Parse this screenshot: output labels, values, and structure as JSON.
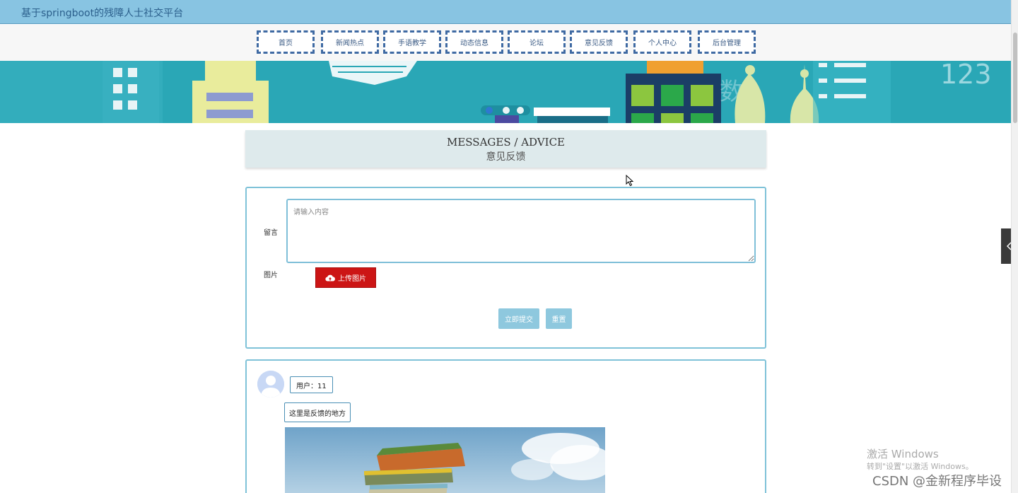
{
  "header": {
    "site_title": "基于springboot的残障人士社交平台"
  },
  "nav": {
    "items": [
      {
        "label": "首页"
      },
      {
        "label": "新闻热点"
      },
      {
        "label": "手语教学"
      },
      {
        "label": "动态信息"
      },
      {
        "label": "论坛"
      },
      {
        "label": "意见反馈"
      },
      {
        "label": "个人中心"
      },
      {
        "label": "后台管理"
      }
    ]
  },
  "banner": {
    "numbers_text": "123",
    "character_text": "数"
  },
  "section": {
    "title_en": "MESSAGES / ADVICE",
    "title_cn": "意见反馈"
  },
  "form": {
    "message_label": "留言",
    "message_placeholder": "请输入内容",
    "image_label": "图片",
    "upload_label": "上传图片",
    "submit_label": "立即提交",
    "reset_label": "重置"
  },
  "feedback_list": {
    "items": [
      {
        "user": "用户：11",
        "content": "这里是反馈的地方"
      }
    ]
  },
  "watermark": {
    "activate_title": "激活 Windows",
    "activate_hint": "转到\"设置\"以激活 Windows。",
    "csdn": "CSDN @金新程序毕设"
  },
  "colors": {
    "topbar": "#88c4e2",
    "nav_border": "#3f6aa3",
    "panel_border": "#7fc2d8",
    "upload_button": "#cc1515",
    "action_button": "#8ec8de",
    "banner": "#2aa7b6"
  }
}
